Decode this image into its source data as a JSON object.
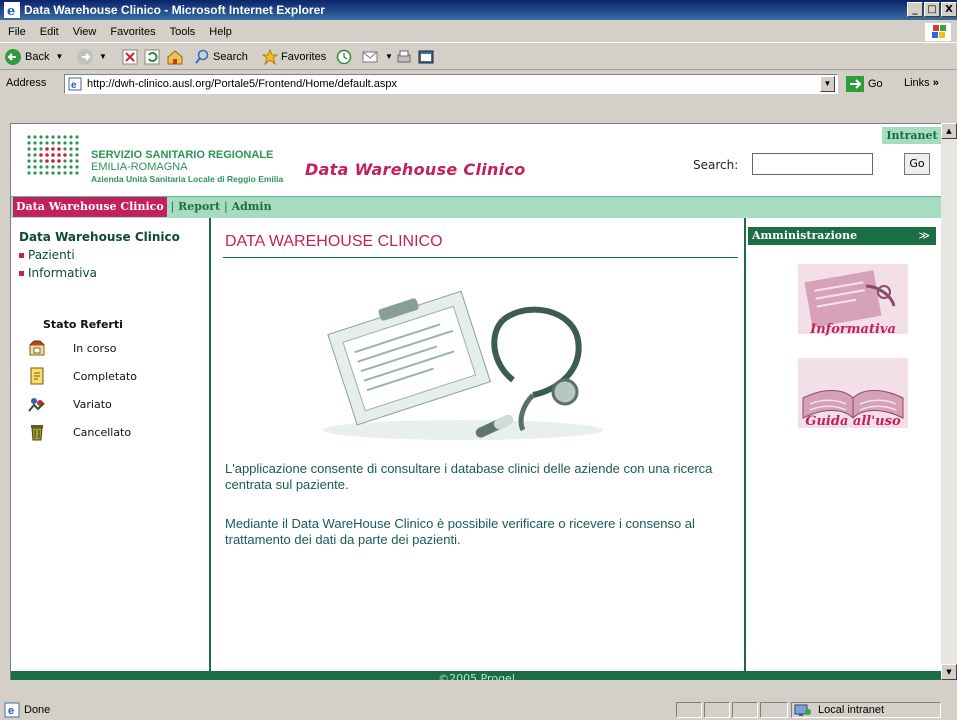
{
  "window": {
    "title": "Data Warehouse Clinico - Microsoft Internet Explorer",
    "controls": [
      "_",
      "□",
      "X"
    ]
  },
  "menu": [
    "File",
    "Edit",
    "View",
    "Favorites",
    "Tools",
    "Help"
  ],
  "toolbar": {
    "back": "Back",
    "search": "Search",
    "favorites": "Favorites"
  },
  "address": {
    "label": "Address",
    "url": "http://dwh-clinico.ausl.org/Portale5/Frontend/Home/default.aspx",
    "go": "Go",
    "links": "Links"
  },
  "header": {
    "intranet": "Intranet",
    "org_line1": "SERVIZIO SANITARIO REGIONALE",
    "org_line2": "EMILIA-ROMAGNA",
    "org_line3": "Azienda Unità Sanitaria Locale di Reggio Emilia",
    "app_title": "Data Warehouse Clinico",
    "search_label": "Search:",
    "search_value": "",
    "search_go": "Go"
  },
  "nav": {
    "active": "Data Warehouse Clinico",
    "items": [
      "Report",
      "Admin"
    ],
    "sep": "|"
  },
  "left": {
    "title": "Data Warehouse Clinico",
    "links": [
      "Pazienti",
      "Informativa"
    ],
    "stato_title": "Stato Referti",
    "stati": [
      {
        "label": "In corso",
        "icon": "in-progress-icon"
      },
      {
        "label": "Completato",
        "icon": "completed-icon"
      },
      {
        "label": "Variato",
        "icon": "changed-icon"
      },
      {
        "label": "Cancellato",
        "icon": "deleted-icon"
      }
    ]
  },
  "main": {
    "heading": "DATA WAREHOUSE CLINICO",
    "para1": "L'applicazione consente di consultare i database clinici delle aziende con una ricerca centrata sul paziente.",
    "para2": "Mediante il Data WareHouse Clinico è possibile verificare o ricevere i consenso al trattamento dei dati da parte dei pazienti."
  },
  "right": {
    "panel_title": "Amministrazione",
    "cards": [
      "Informativa",
      "Guida all'uso"
    ]
  },
  "footer": "©2005 Progel",
  "status": {
    "text": "Done",
    "zone": "Local intranet"
  },
  "colors": {
    "brand_green": "#1b6e44",
    "accent_pink": "#c4215c",
    "nav_green": "#a8dcc0"
  }
}
